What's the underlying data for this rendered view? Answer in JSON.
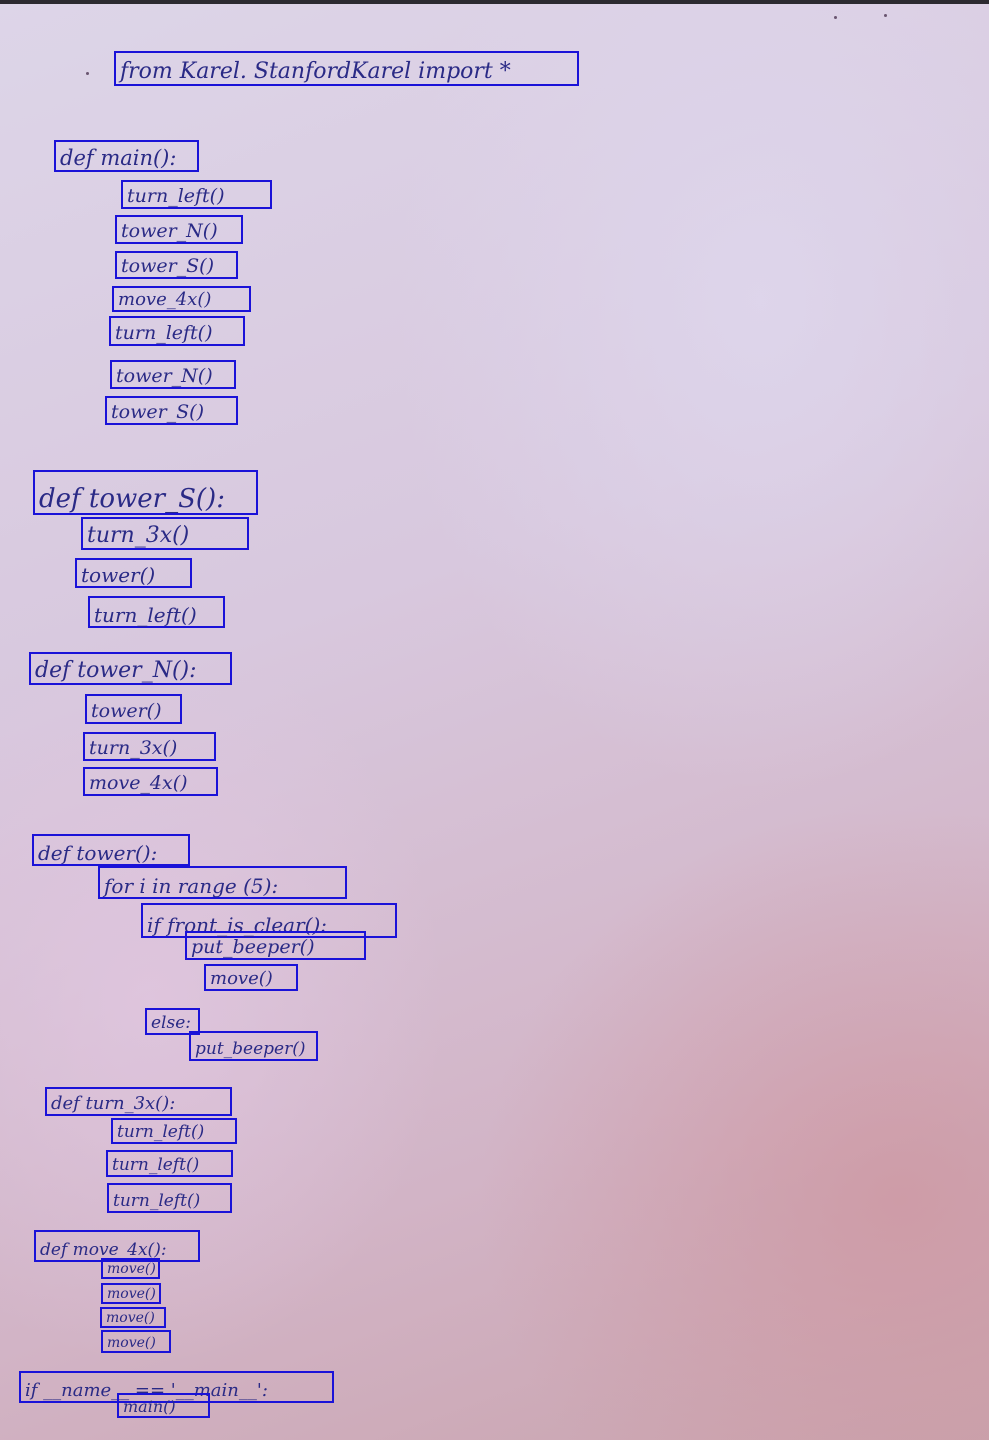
{
  "document": {
    "lines": [
      "from Karel. StanfordKarel import *",
      "def main():",
      "turn_left()",
      "tower_N()",
      "tower_S()",
      "move_4x()",
      "turn_left()",
      "tower_N()",
      "tower_S()",
      "def tower_S():",
      "turn_3x()",
      "tower()",
      "turn_left()",
      "def tower_N():",
      "tower()",
      "turn_3x()",
      "move_4x()",
      "def tower():",
      "for i in range (5):",
      "if front_is_clear():",
      "put_beeper()",
      "move()",
      "else:",
      "put_beeper()",
      "def turn_3x():",
      "turn_left()",
      "turn_left()",
      "turn_left()",
      "def move_4x():",
      "move()",
      "move()",
      "move()",
      "move()",
      "if __name__ == '__main__':",
      "main()"
    ],
    "ink_color": "#2a2a86",
    "box_color": "#1a12d8"
  }
}
